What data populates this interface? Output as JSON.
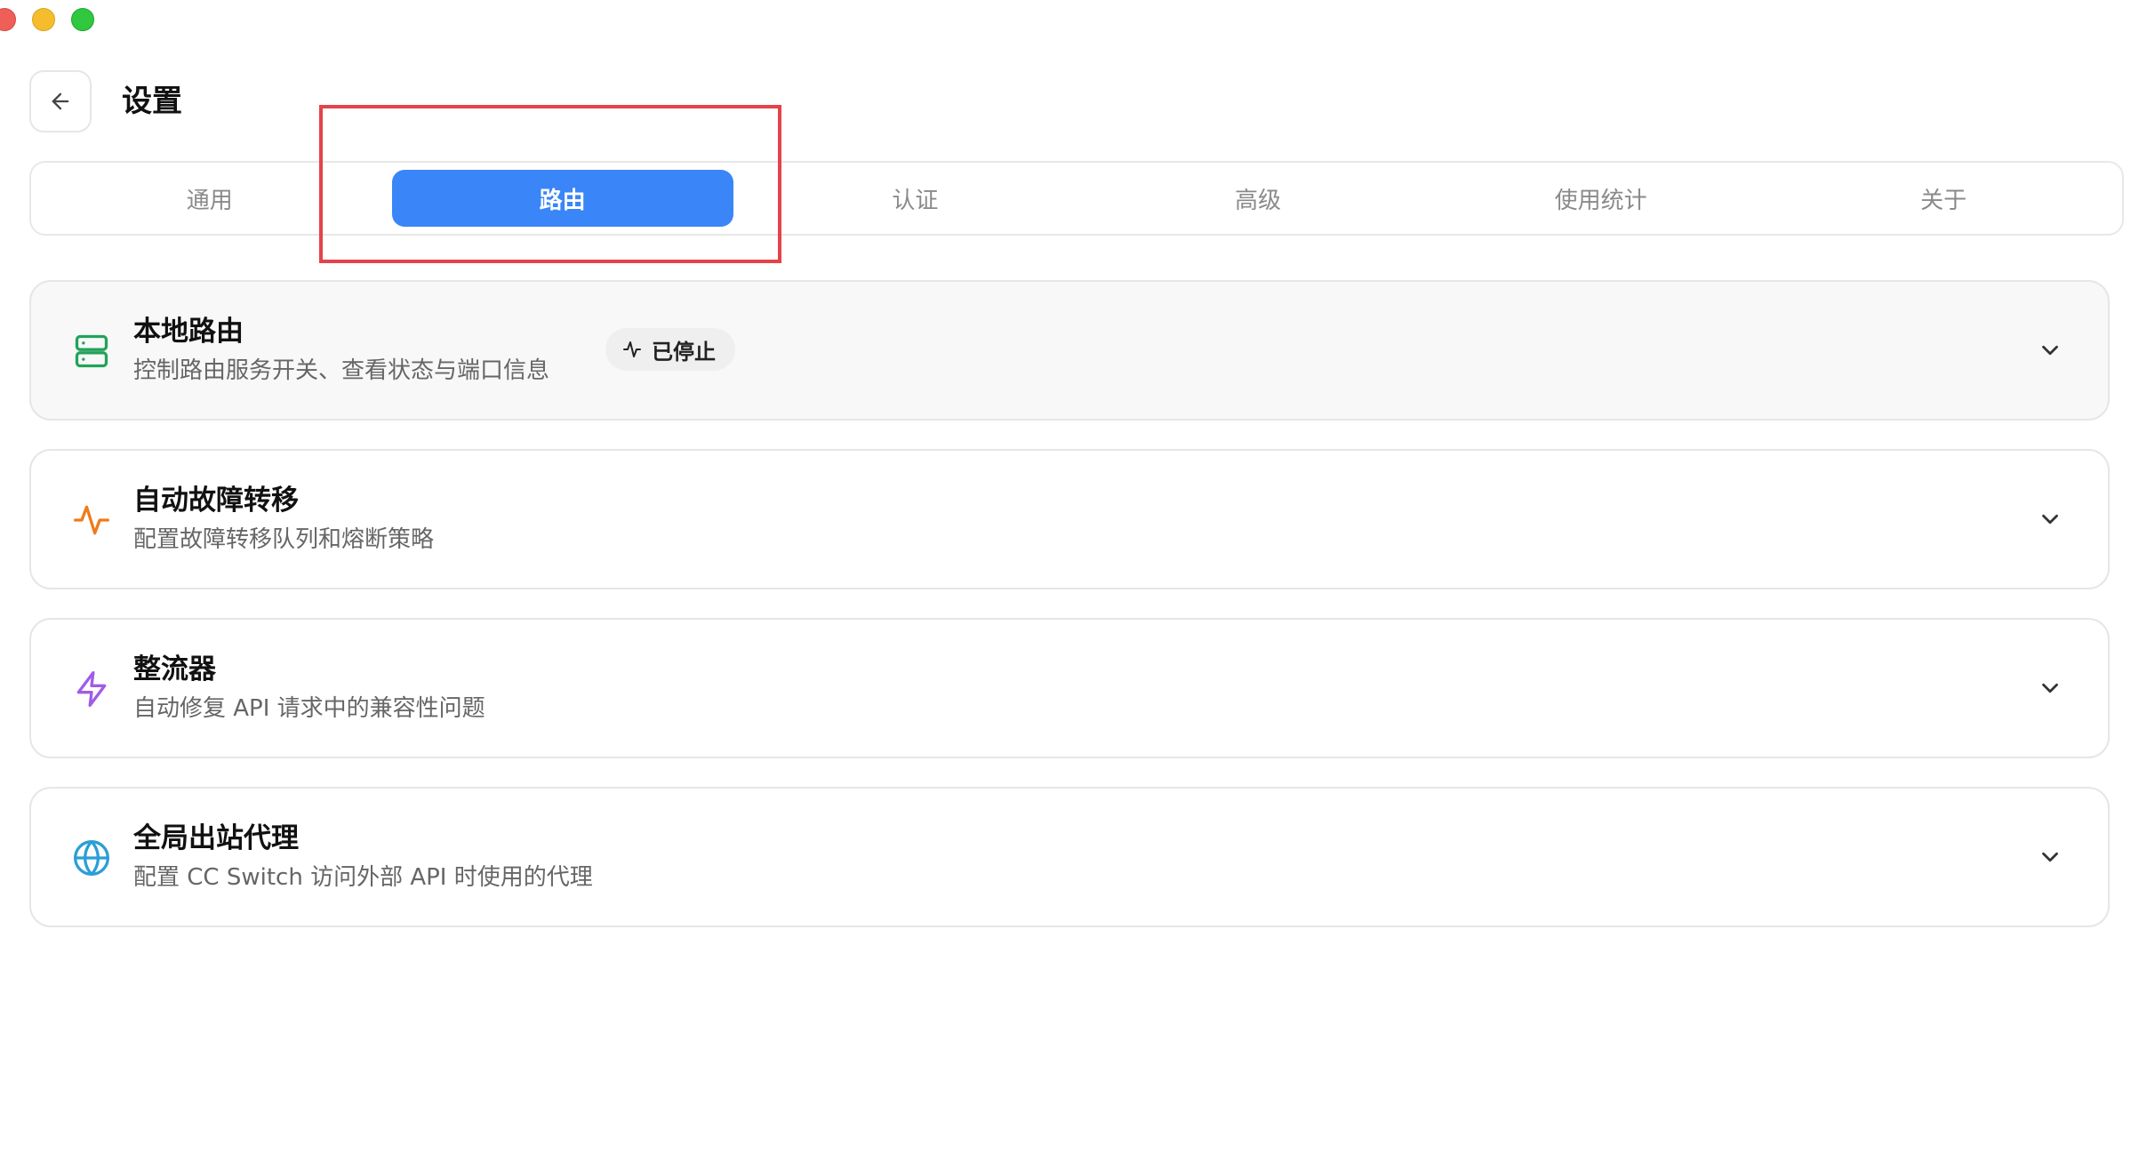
{
  "window": {
    "controls": [
      "close",
      "minimize",
      "zoom"
    ]
  },
  "header": {
    "back_icon": "arrow-left-icon",
    "title": "设置"
  },
  "tabs": [
    {
      "label": "通用",
      "active": false
    },
    {
      "label": "路由",
      "active": true
    },
    {
      "label": "认证",
      "active": false
    },
    {
      "label": "高级",
      "active": false
    },
    {
      "label": "使用统计",
      "active": false
    },
    {
      "label": "关于",
      "active": false
    }
  ],
  "cards": [
    {
      "icon": "server-icon",
      "icon_color": "#22a35a",
      "title": "本地路由",
      "description": "控制路由服务开关、查看状态与端口信息",
      "status": {
        "icon": "activity-icon",
        "label": "已停止"
      }
    },
    {
      "icon": "activity-icon",
      "icon_color": "#f07a1a",
      "title": "自动故障转移",
      "description": "配置故障转移队列和熔断策略"
    },
    {
      "icon": "lightning-icon",
      "icon_color": "#a05ce8",
      "title": "整流器",
      "description": "自动修复 API 请求中的兼容性问题"
    },
    {
      "icon": "globe-icon",
      "icon_color": "#2b9ed6",
      "title": "全局出站代理",
      "description": "配置 CC Switch 访问外部 API 时使用的代理"
    }
  ],
  "colors": {
    "accent": "#3a85f7",
    "highlight": "#e5424a"
  }
}
